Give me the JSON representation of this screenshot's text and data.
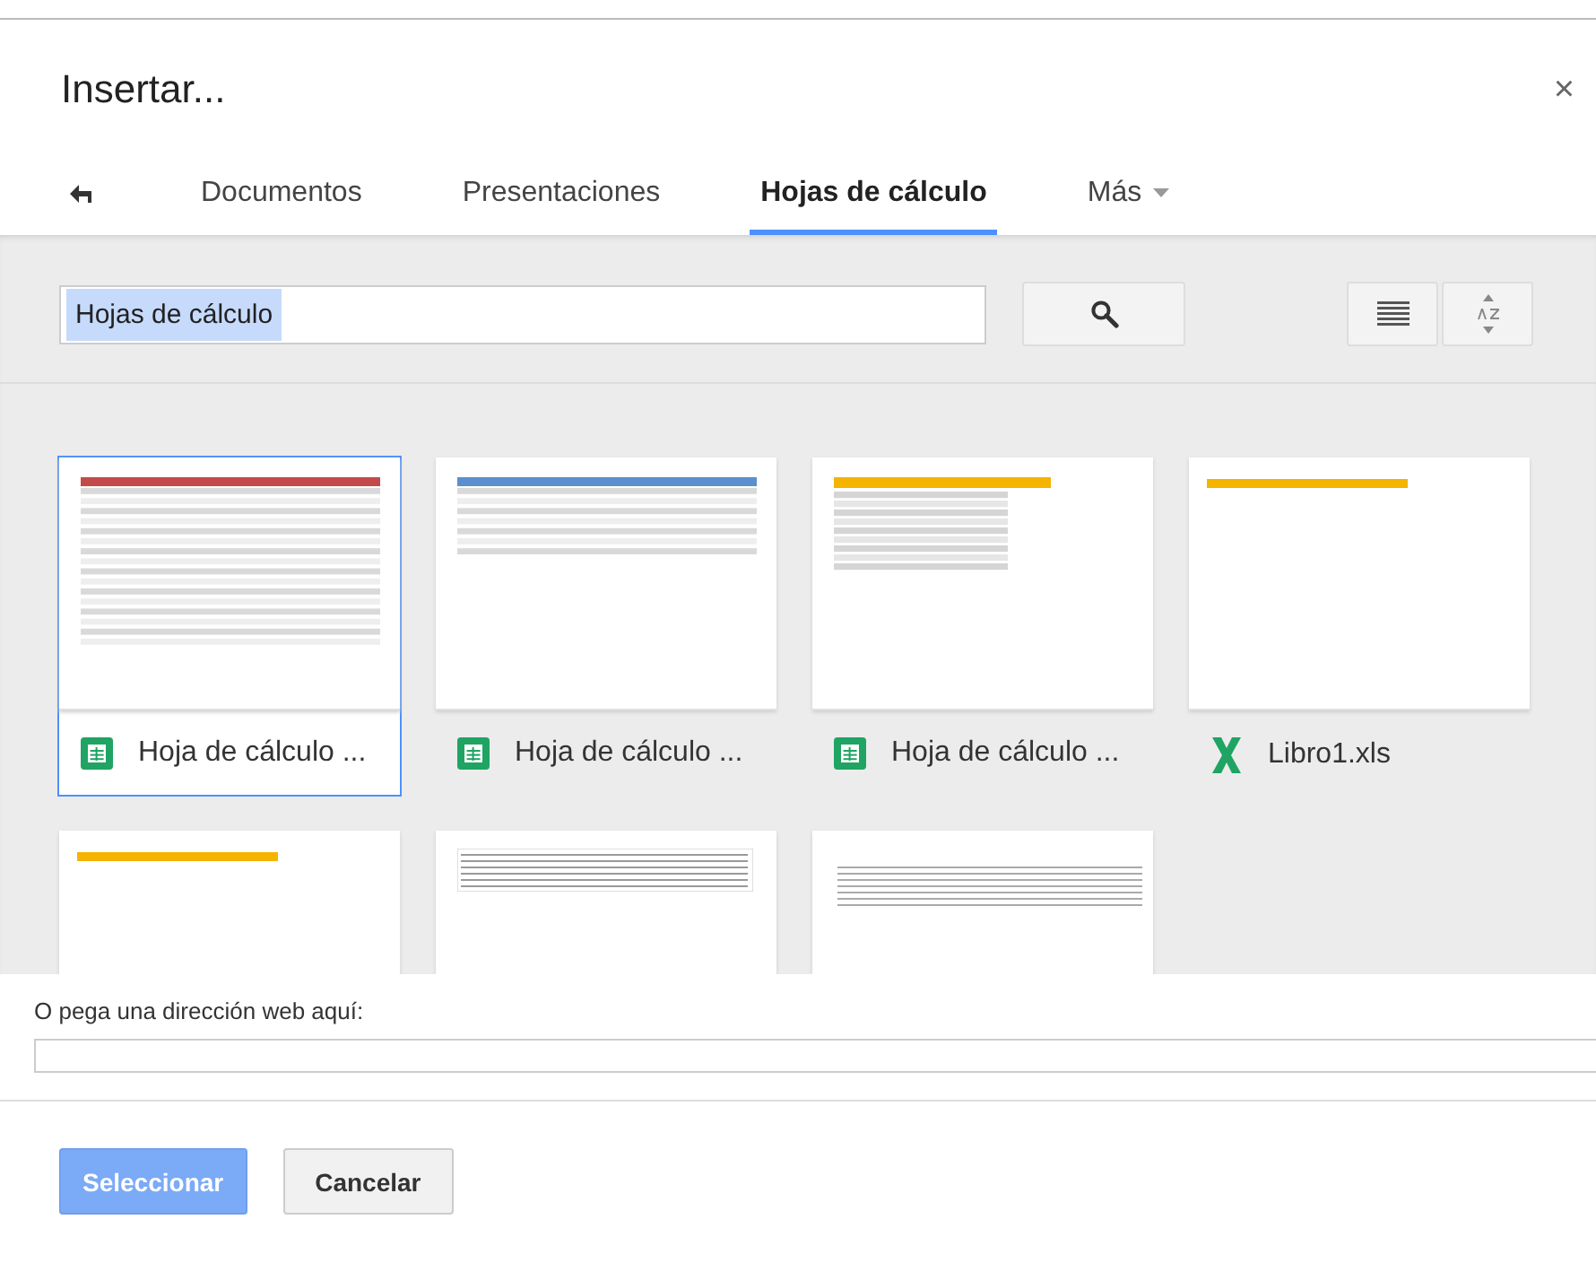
{
  "dialog": {
    "title": "Insertar...",
    "close": "×"
  },
  "tabs": [
    {
      "kind": "tab",
      "label": "Documentos",
      "selected": false
    },
    {
      "kind": "tab",
      "label": "Presentaciones",
      "selected": false
    },
    {
      "kind": "tab",
      "label": "Hojas de cálculo",
      "selected": true
    },
    {
      "kind": "menu",
      "label": "Más",
      "selected": false
    }
  ],
  "search": {
    "value": "Hojas de cálculo"
  },
  "files": [
    {
      "name": "Hoja de cálculo ...",
      "kind": "sheets",
      "preview": {
        "kind": "red"
      },
      "selected": true
    },
    {
      "name": "Hoja de cálculo ...",
      "kind": "sheets",
      "preview": {
        "kind": "blue"
      },
      "selected": false
    },
    {
      "name": "Hoja de cálculo ...",
      "kind": "sheets",
      "preview": {
        "kind": "grid"
      },
      "selected": false
    },
    {
      "name": "Libro1.xls",
      "kind": "excel",
      "preview": {
        "kind": "banner"
      },
      "selected": false
    },
    {
      "preview": {
        "kind": "banner"
      },
      "selected": false
    },
    {
      "preview": {
        "kind": "table"
      },
      "selected": false
    },
    {
      "preview": {
        "kind": "rows"
      },
      "selected": false
    }
  ],
  "url": {
    "label": "O pega una dirección web aquí:"
  },
  "buttons": [
    {
      "label": "Seleccionar",
      "kind": "primary",
      "disabled": true
    },
    {
      "label": "Cancelar",
      "kind": "secondary",
      "disabled": false
    }
  ]
}
